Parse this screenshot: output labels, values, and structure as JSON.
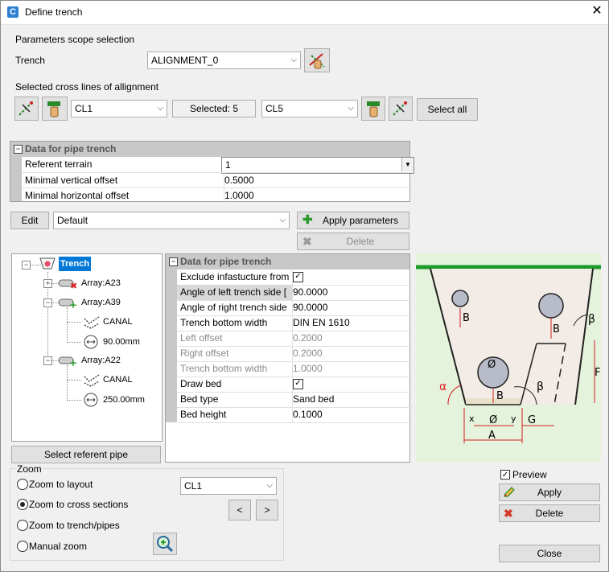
{
  "window": {
    "title": "Define trench",
    "app_icon": "C"
  },
  "scope": {
    "section_label": "Parameters scope selection",
    "trench_label": "Trench",
    "trench_value": "ALIGNMENT_0",
    "cross_lines_label": "Selected cross lines of allignment",
    "from_value": "CL1",
    "selected_text": "Selected: 5",
    "to_value": "CL5",
    "select_all": "Select all"
  },
  "top_grid": {
    "header": "Data for pipe trench",
    "rows": [
      {
        "name": "Referent terrain",
        "value": "1"
      },
      {
        "name": "Minimal vertical offset",
        "value": "0.5000"
      },
      {
        "name": "Minimal horizontal offset",
        "value": "1.0000"
      }
    ]
  },
  "preset": {
    "edit": "Edit",
    "value": "Default",
    "apply_params": "Apply parameters",
    "delete": "Delete"
  },
  "tree": {
    "root": "Trench",
    "items": [
      {
        "label": "Array:A23"
      },
      {
        "label": "Array:A39"
      },
      {
        "label": "CANAL"
      },
      {
        "label": "90.00mm"
      },
      {
        "label": "Array:A22"
      },
      {
        "label": "CANAL"
      },
      {
        "label": "250.00mm"
      }
    ],
    "select_ref_pipe": "Select referent pipe"
  },
  "pipe_grid": {
    "header": "Data for pipe trench",
    "rows": [
      {
        "name": "Exclude infastucture from",
        "value": "",
        "check": "✓",
        "disabled": false
      },
      {
        "name": "Angle of left trench side [",
        "value": "90.0000",
        "disabled": false
      },
      {
        "name": "Angle of right trench side",
        "value": "90.0000",
        "disabled": false
      },
      {
        "name": "Trench bottom width",
        "value": "DIN EN 1610",
        "disabled": false
      },
      {
        "name": "Left offset",
        "value": "0.2000",
        "disabled": true
      },
      {
        "name": "Right offset",
        "value": "0.2000",
        "disabled": true
      },
      {
        "name": "Trench bottom width",
        "value": "1.0000",
        "disabled": true
      },
      {
        "name": "Draw bed",
        "value": "",
        "check": "✓",
        "disabled": false
      },
      {
        "name": "Bed type",
        "value": "Sand bed",
        "disabled": false
      },
      {
        "name": "Bed height",
        "value": "0.1000",
        "disabled": false
      }
    ]
  },
  "diagram": {
    "labels": {
      "B": "B",
      "phi": "Ø",
      "beta": "β",
      "alpha": "α",
      "F": "F",
      "x": "x",
      "y": "y",
      "G": "G",
      "A": "A"
    }
  },
  "zoom": {
    "legend": "Zoom",
    "options": [
      "Zoom to layout",
      "Zoom to cross sections",
      "Zoom to trench/pipes",
      "Manual zoom"
    ],
    "selected_index": 1,
    "cl_value": "CL1",
    "prev": "<",
    "next": ">"
  },
  "actions": {
    "preview_label": "Preview",
    "preview_checked": "✓",
    "apply": "Apply",
    "delete": "Delete",
    "close": "Close"
  }
}
